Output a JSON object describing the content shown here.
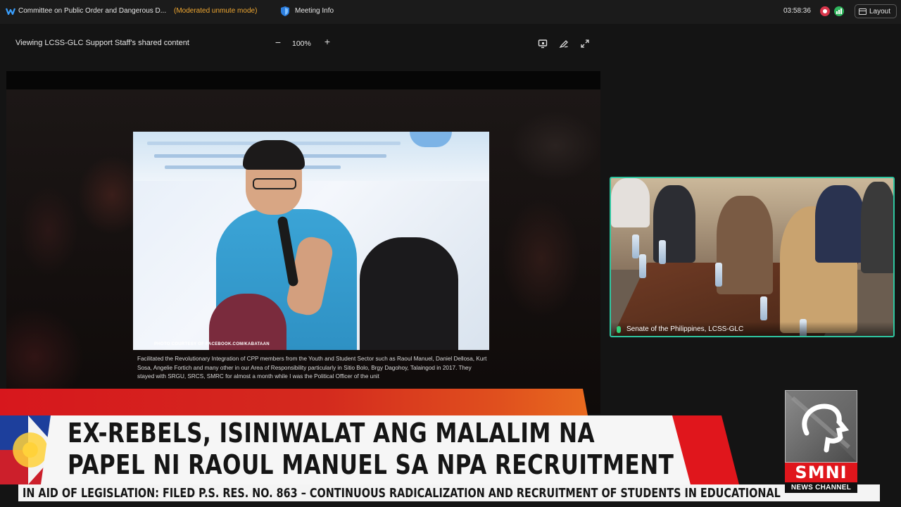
{
  "topbar": {
    "meeting_title": "Committee on Public Order and Dangerous D...",
    "mode": "(Moderated unmute mode)",
    "meeting_info": "Meeting Info",
    "timer": "03:58:36",
    "layout_label": "Layout"
  },
  "share_bar": {
    "viewing_text": "Viewing LCSS-GLC Support Staff's shared content",
    "zoom_out": "−",
    "zoom_level": "100%",
    "zoom_in": "+"
  },
  "slide": {
    "photo_credit": "PHOTO COURTESY OF FACEBOOK.COM/KABATAAN",
    "caption": "Facilitated the Revolutionary Integration of CPP members from the Youth and Student Sector such as Raoul Manuel, Daniel Dellosa, Kurt Sosa, Angelie Fortich and many other in our Area of Responsibility particularly in Sitio Bolo, Brgy Dagohoy, Talaingod in 2017. They stayed with SRGU, SRCS, SMRC for almost a month while I was the Political Officer of the unit"
  },
  "video_tile": {
    "participant_name": "Senate of the Philippines, LCSS-GLC"
  },
  "broadcast": {
    "headline_line1": "EX-REBELS, ISINIWALAT ANG MALALIM NA",
    "headline_line2": "PAPEL NI RAOUL MANUEL SA NPA RECRUITMENT",
    "ticker": "IN AID OF LEGISLATION: FILED P.S. RES. NO. 863 – CONTINUOUS RADICALIZATION AND RECRUITMENT OF STUDENTS IN EDUCATIONAL",
    "logo_text": "SMNI",
    "logo_subtext": "NEWS CHANNEL"
  },
  "colors": {
    "mode_text": "#f0a832",
    "active_speaker_border": "#2fc6a0",
    "headline_red": "#e0161c",
    "record": "#d8364b",
    "stats": "#2fb55c"
  },
  "icons": [
    "webex-app-icon",
    "shield-icon",
    "record-icon",
    "stats-icon",
    "layout-icon",
    "share-view-icon",
    "annotate-icon",
    "fullscreen-icon",
    "mic-icon",
    "sun-icon",
    "smni-logo-icon"
  ]
}
